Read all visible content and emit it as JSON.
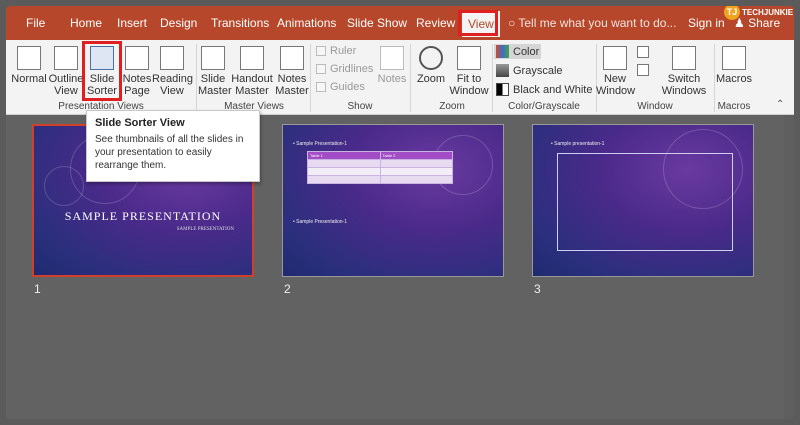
{
  "tabs": [
    "File",
    "Home",
    "Insert",
    "Design",
    "Transitions",
    "Animations",
    "Slide Show",
    "Review",
    "View"
  ],
  "tell_me": "Tell me what you want to do...",
  "sign_in": "Sign in",
  "share": "Share",
  "logo": {
    "badge": "TJ",
    "text": "TECHJUNKIE"
  },
  "ribbon": {
    "presentation_views": {
      "label": "Presentation Views",
      "buttons": [
        "Normal",
        "Outline View",
        "Slide Sorter",
        "Notes Page",
        "Reading View"
      ]
    },
    "master_views": {
      "label": "Master Views",
      "buttons": [
        "Slide Master",
        "Handout Master",
        "Notes Master"
      ]
    },
    "show": {
      "label": "Show",
      "items": [
        "Ruler",
        "Gridlines",
        "Guides"
      ],
      "notes": "Notes"
    },
    "zoom": {
      "label": "Zoom",
      "buttons": [
        "Zoom",
        "Fit to Window"
      ]
    },
    "color": {
      "label": "Color/Grayscale",
      "items": [
        "Color",
        "Grayscale",
        "Black and White"
      ]
    },
    "window": {
      "label": "Window",
      "buttons": [
        "New Window",
        "Switch Windows"
      ]
    },
    "macros": {
      "label": "Macros",
      "buttons": [
        "Macros"
      ]
    }
  },
  "tooltip": {
    "title": "Slide Sorter View",
    "body": "See thumbnails of all the slides in your presentation to easily rearrange them."
  },
  "slides": [
    {
      "num": "1",
      "title": "SAMPLE PRESENTATION",
      "subtitle": "SAMPLE PRESENTATION"
    },
    {
      "num": "2",
      "bullet1": "Sample Presentation-1",
      "table_h1": "Table 1",
      "table_h2": "Table 2",
      "bullet2": "Sample Presentation-1"
    },
    {
      "num": "3",
      "bullet1": "Sample presentation-1"
    }
  ],
  "colors": {
    "accent": "#b7472a",
    "highlight": "#e02020"
  }
}
